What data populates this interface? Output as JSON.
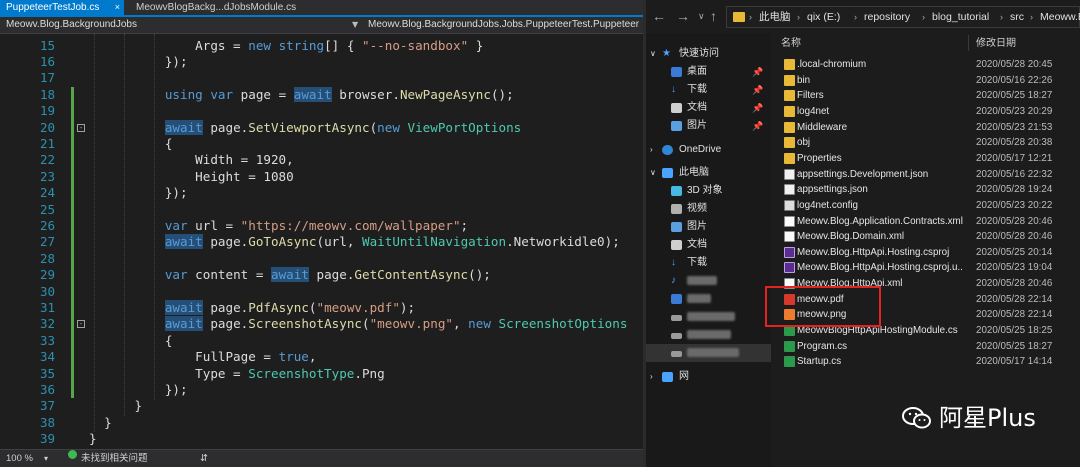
{
  "editor": {
    "tabs": [
      {
        "label": "PuppeteerTestJob.cs",
        "close": "×",
        "active": true
      },
      {
        "label": "MeowvBlogBackg...dJobsModule.cs",
        "close": "",
        "active": false
      }
    ],
    "nav_left": "Meowv.Blog.BackgroundJobs",
    "nav_right": "Meowv.Blog.BackgroundJobs.Jobs.PuppeteerTest.Puppeteer",
    "line_numbers": [
      "15",
      "16",
      "17",
      "18",
      "19",
      "20",
      "21",
      "22",
      "23",
      "24",
      "25",
      "26",
      "27",
      "28",
      "29",
      "30",
      "31",
      "32",
      "33",
      "34",
      "35",
      "36",
      "37",
      "38",
      "39"
    ],
    "status": {
      "zoom": "100 %",
      "issues": "未找到相关问题"
    }
  },
  "explorer": {
    "breadcrumbs": [
      "此电脑",
      "qix (E:)",
      "repository",
      "blog_tutorial",
      "src",
      "Meoww.Blog.H"
    ],
    "nav": {
      "quick_access": "快速访问",
      "desktop": "桌面",
      "downloads": "下载",
      "documents": "文档",
      "pictures": "图片",
      "onedrive": "OneDrive",
      "this_pc": "此电脑",
      "objects3d": "3D 对象",
      "videos": "视频",
      "pictures2": "图片",
      "documents2": "文档",
      "downloads2": "下载",
      "network": "网"
    },
    "headers": {
      "name": "名称",
      "date": "修改日期"
    },
    "files": [
      {
        "name": ".local-chromium",
        "date": "2020/05/28 20:45",
        "icon": "folder"
      },
      {
        "name": "bin",
        "date": "2020/05/16 22:26",
        "icon": "folder"
      },
      {
        "name": "Filters",
        "date": "2020/05/25 18:27",
        "icon": "folder"
      },
      {
        "name": "log4net",
        "date": "2020/05/23 20:29",
        "icon": "folder"
      },
      {
        "name": "Middleware",
        "date": "2020/05/23 21:53",
        "icon": "folder"
      },
      {
        "name": "obj",
        "date": "2020/05/28 20:38",
        "icon": "folder"
      },
      {
        "name": "Properties",
        "date": "2020/05/17 12:21",
        "icon": "folder"
      },
      {
        "name": "appsettings.Development.json",
        "date": "2020/05/16 22:32",
        "icon": "json"
      },
      {
        "name": "appsettings.json",
        "date": "2020/05/28 19:24",
        "icon": "json"
      },
      {
        "name": "log4net.config",
        "date": "2020/05/23 20:22",
        "icon": "config"
      },
      {
        "name": "Meowv.Blog.Application.Contracts.xml",
        "date": "2020/05/28 20:46",
        "icon": "xml"
      },
      {
        "name": "Meowv.Blog.Domain.xml",
        "date": "2020/05/28 20:46",
        "icon": "xml"
      },
      {
        "name": "Meowv.Blog.HttpApi.Hosting.csproj",
        "date": "2020/05/25 20:14",
        "icon": "csproj"
      },
      {
        "name": "Meowv.Blog.HttpApi.Hosting.csproj.u...",
        "date": "2020/05/23 19:04",
        "icon": "csproj"
      },
      {
        "name": "Meowv.Blog.HttpApi.xml",
        "date": "2020/05/28 20:46",
        "icon": "xml"
      },
      {
        "name": "meowv.pdf",
        "date": "2020/05/28 22:14",
        "icon": "pdf"
      },
      {
        "name": "meowv.png",
        "date": "2020/05/28 22:14",
        "icon": "png"
      },
      {
        "name": "MeowvBlogHttpApiHostingModule.cs",
        "date": "2020/05/25 18:25",
        "icon": "cs"
      },
      {
        "name": "Program.cs",
        "date": "2020/05/25 18:27",
        "icon": "cs"
      },
      {
        "name": "Startup.cs",
        "date": "2020/05/17 14:14",
        "icon": "cs"
      }
    ]
  },
  "watermark": {
    "text": "阿星Plus"
  },
  "colors": {
    "accent": "#007acc",
    "highlight": "#e12323"
  }
}
